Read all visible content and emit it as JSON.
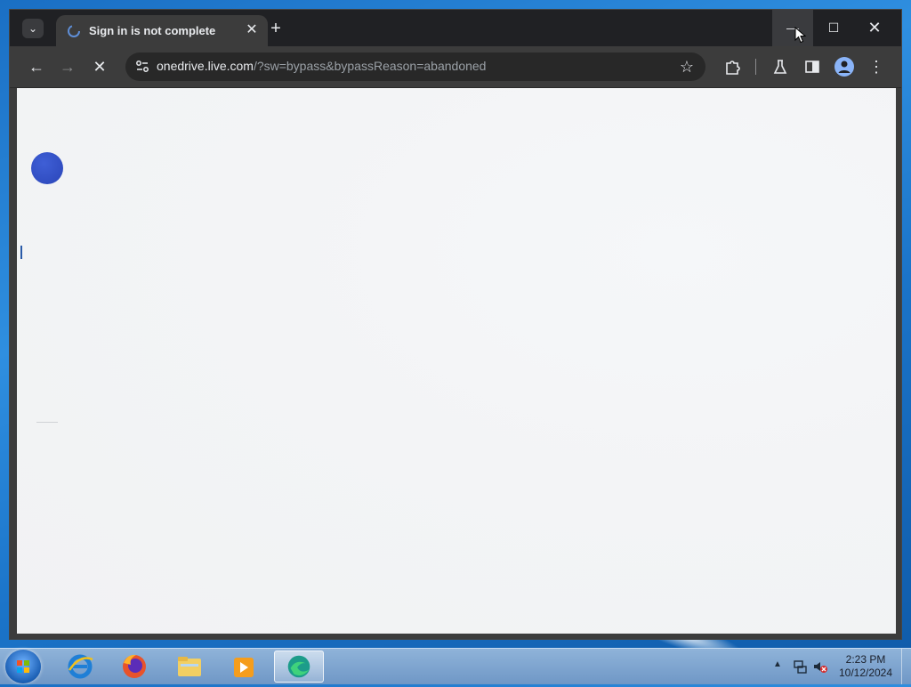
{
  "browser": {
    "tab": {
      "title": "Sign in is not complete",
      "close_glyph": "✕"
    },
    "new_tab_glyph": "+",
    "tab_search_glyph": "⌄",
    "window_controls": {
      "minimize": "—",
      "maximize": "☐",
      "close": "✕"
    },
    "toolbar": {
      "back_glyph": "←",
      "forward_glyph": "→",
      "stop_glyph": "✕",
      "url_host": "onedrive.live.com",
      "url_rest": "/?sw=bypass&bypassReason=abandoned",
      "star_glyph": "☆",
      "menu_glyph": "⋮"
    }
  },
  "taskbar": {
    "apps": [
      "internet-explorer",
      "firefox",
      "file-explorer",
      "media-player",
      "edge"
    ],
    "tray": {
      "arrow": "▲"
    },
    "clock": {
      "time": "2:23 PM",
      "date": "10/12/2024"
    }
  },
  "colors": {
    "titlebar": "#202124",
    "toolbar": "#3c3c3c",
    "page_bg": "#f3f4f6",
    "logo_dot": "#3350c8"
  }
}
